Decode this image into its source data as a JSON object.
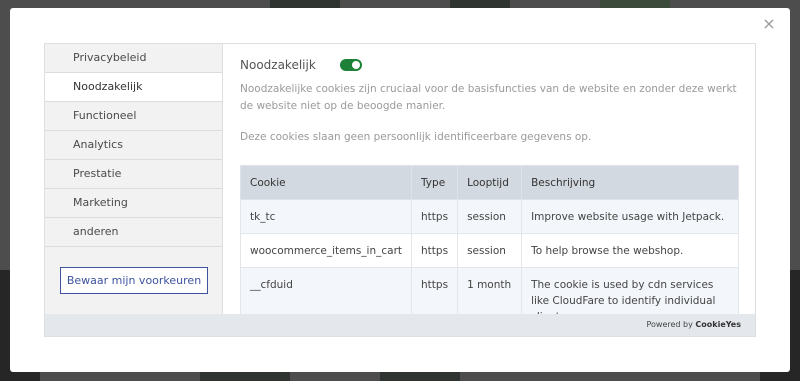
{
  "close_label": "×",
  "sidebar": {
    "items": [
      {
        "label": "Privacybeleid"
      },
      {
        "label": "Noodzakelijk"
      },
      {
        "label": "Functioneel"
      },
      {
        "label": "Analytics"
      },
      {
        "label": "Prestatie"
      },
      {
        "label": "Marketing"
      },
      {
        "label": "anderen"
      }
    ],
    "active_index": 1,
    "save_label": "Bewaar mijn voorkeuren"
  },
  "section": {
    "title": "Noodzakelijk",
    "toggle_on": true,
    "description": "Noodzakelijke cookies zijn cruciaal voor de basisfuncties van de website en zonder deze werkt de website niet op de beoogde manier.",
    "note": "Deze cookies slaan geen persoonlijk identificeerbare gegevens op."
  },
  "table": {
    "headers": [
      "Cookie",
      "Type",
      "Looptijd",
      "Beschrijving"
    ],
    "rows": [
      [
        "tk_tc",
        "https",
        "session",
        "Improve website usage with Jetpack."
      ],
      [
        "woocommerce_items_in_cart",
        "https",
        "session",
        "To help browse the webshop."
      ],
      [
        "__cfduid",
        "https",
        "1 month",
        "The cookie is used by cdn services like CloudFare to identify individual clients"
      ]
    ]
  },
  "footer": {
    "prefix": "Powered by",
    "brand": "CookieYes"
  },
  "colors": {
    "accent": "#3d53a0",
    "toggle": "#1d8237",
    "table_header": "#d3d9e0"
  }
}
